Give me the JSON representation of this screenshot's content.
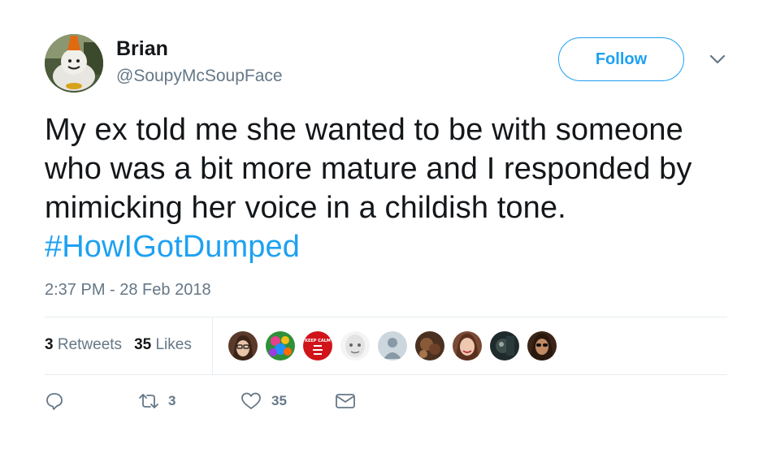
{
  "user": {
    "name": "Brian",
    "handle": "@SoupyMcSoupFace",
    "avatar_icon": "snowman-avatar"
  },
  "follow_label": "Follow",
  "tweet": {
    "text": "My ex told me she wanted to be with someone who was a bit more mature and I responded by mimicking her voice in a childish tone.",
    "hashtag": "#HowIGotDumped",
    "timestamp": "2:37 PM - 28 Feb 2018"
  },
  "stats": {
    "retweets_count": "3",
    "retweets_label": "Retweets",
    "likes_count": "35",
    "likes_label": "Likes"
  },
  "liker_avatars": [
    "woman-glasses-avatar",
    "colorful-floral-avatar",
    "keep-calm-avatar",
    "bald-face-avatar",
    "default-user-avatar",
    "dark-photo-avatar",
    "smiling-woman-avatar",
    "dark-scene-avatar",
    "woman-sunglasses-avatar"
  ],
  "keep_calm_text": "KEEP CALM",
  "actions": {
    "reply_icon": "reply-icon",
    "retweet_icon": "retweet-icon",
    "retweet_count": "3",
    "like_icon": "heart-icon",
    "like_count": "35",
    "message_icon": "envelope-icon"
  },
  "colors": {
    "accent": "#1da1f2",
    "muted": "#657786",
    "text": "#14171a",
    "divider": "#e6ecf0"
  }
}
